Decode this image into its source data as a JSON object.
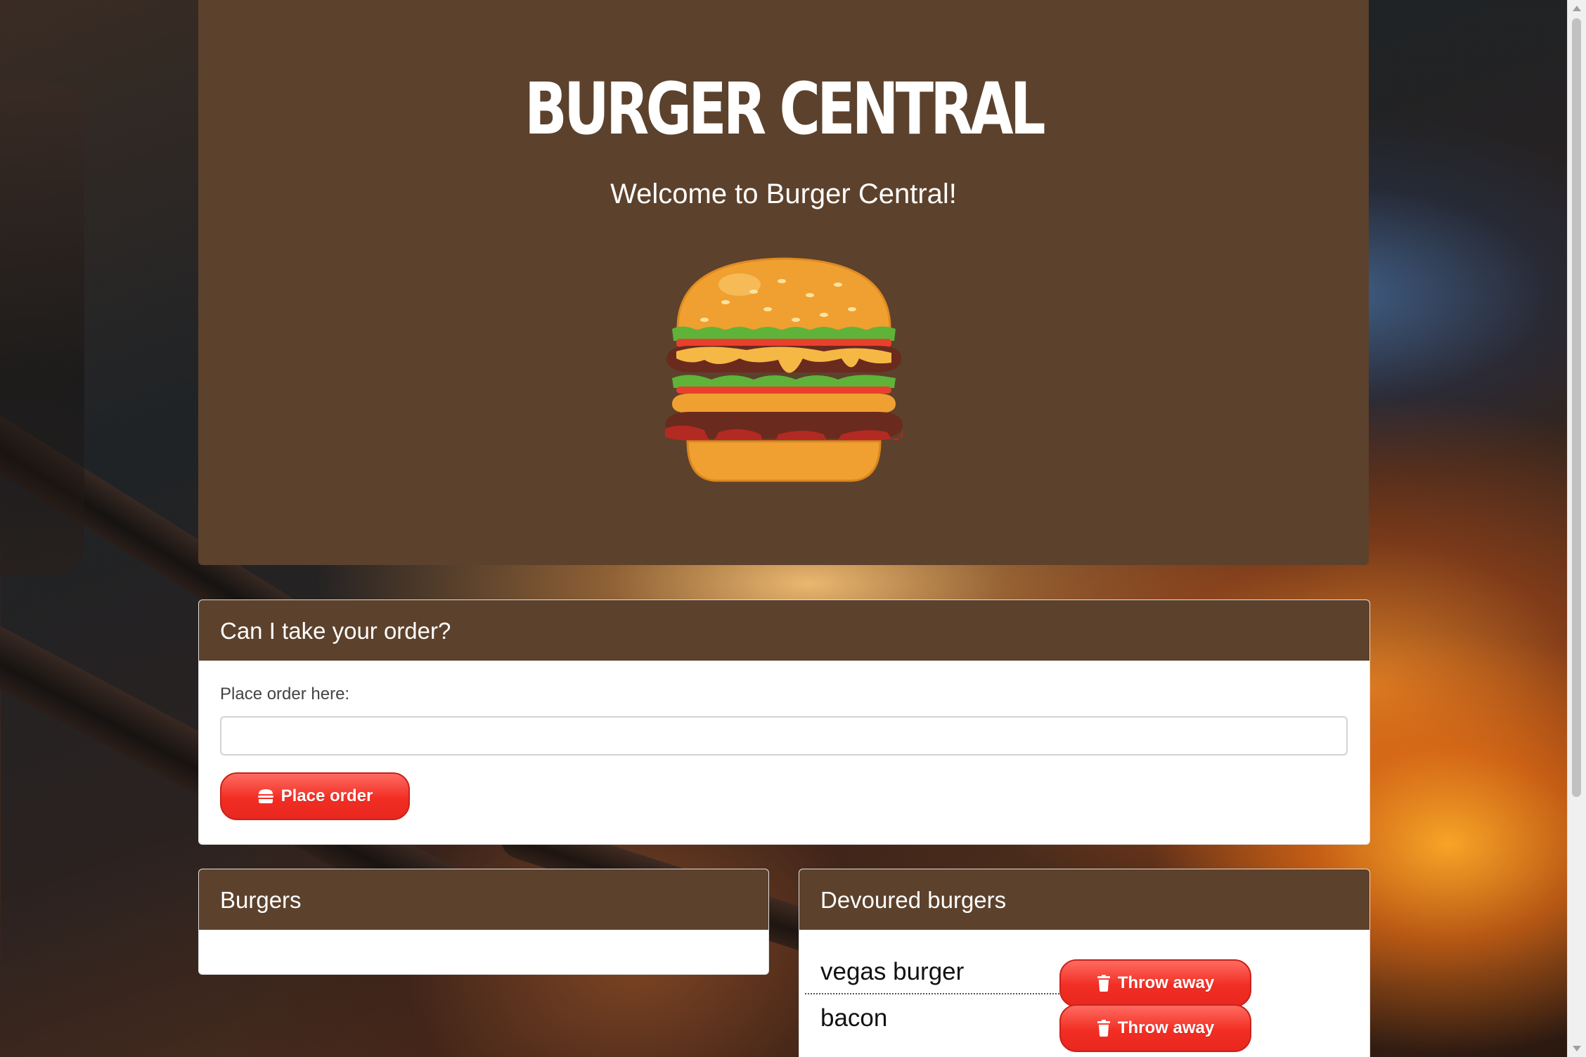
{
  "header": {
    "title": "BURGER CENTRAL",
    "welcome": "Welcome to Burger Central!"
  },
  "order_form": {
    "card_title": "Can I take your order?",
    "label": "Place order here:",
    "input_value": "",
    "button_label": "Place order",
    "button_icon": "hamburger-icon"
  },
  "burgers": {
    "card_title": "Burgers",
    "items": []
  },
  "devoured": {
    "card_title": "Devoured burgers",
    "items": [
      {
        "name": "vegas burger",
        "button_label": "Throw away",
        "button_icon": "trash-icon"
      },
      {
        "name": "bacon",
        "button_label": "Throw away",
        "button_icon": "trash-icon"
      }
    ]
  },
  "colors": {
    "brand_brown": "#5c412c",
    "button_red": "#f22e24",
    "text_white": "#ffffff"
  }
}
